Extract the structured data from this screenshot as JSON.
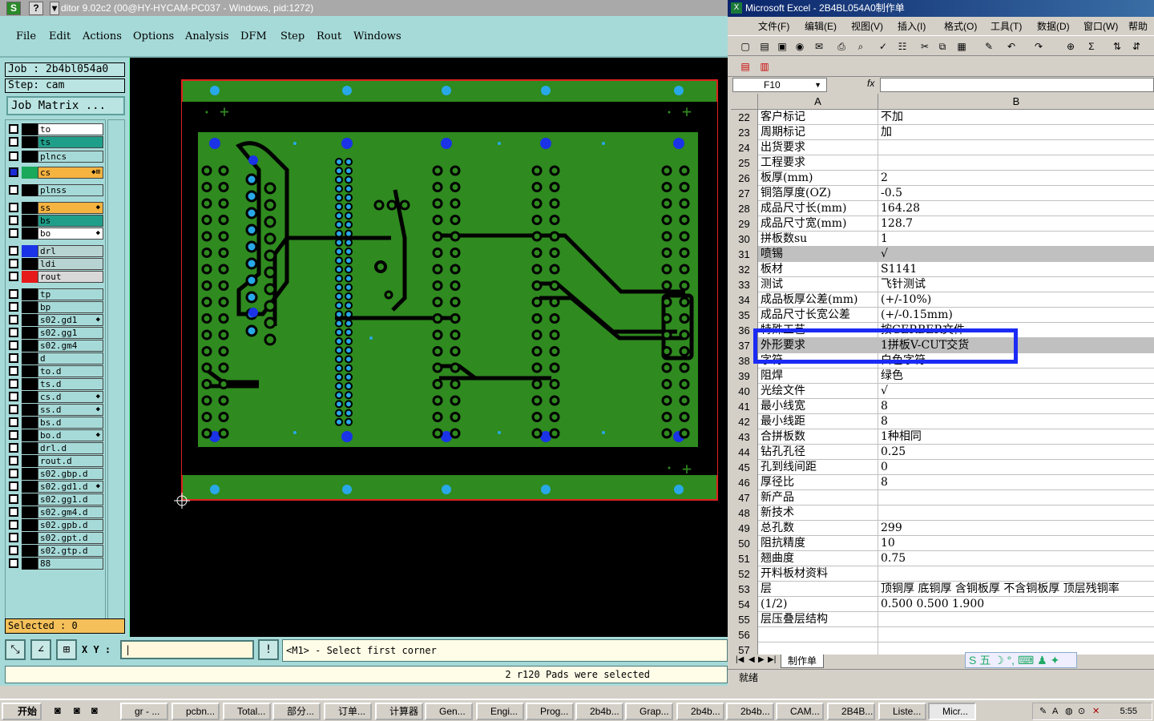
{
  "genesis": {
    "title": "ditor 9.02c2 (00@HY-HYCAM-PC037 - Windows, pid:1272)",
    "menu": [
      "File",
      "Edit",
      "Actions",
      "Options",
      "Analysis",
      "DFM",
      "Step",
      "Rout",
      "Windows"
    ],
    "job": "Job : 2b4bl054a0",
    "step": "Step: cam",
    "job_matrix": "Job Matrix ...",
    "layers": [
      {
        "name": "to",
        "color": "#000000",
        "bg": "#ffffff"
      },
      {
        "name": "ts",
        "color": "#000000",
        "bg": "#1f9f8a"
      },
      {
        "name": "plncs",
        "color": "#000000",
        "bg": "#a6dad8"
      },
      {
        "name": "cs",
        "color": "#1aa85a",
        "bg": "#f5b340",
        "mark": "◆⊞"
      },
      {
        "name": "plnss",
        "color": "#000000",
        "bg": "#a6dad8"
      },
      {
        "name": "ss",
        "color": "#000000",
        "bg": "#f5b340",
        "mark": "◆"
      },
      {
        "name": "bs",
        "color": "#000000",
        "bg": "#1f9f8a"
      },
      {
        "name": "bo",
        "color": "#000000",
        "bg": "#ffffff",
        "mark": "◆"
      },
      {
        "name": "drl",
        "color": "#1a33e6",
        "bg": "#b8d4d2"
      },
      {
        "name": "ldi",
        "color": "#000000",
        "bg": "#b8d4d2"
      },
      {
        "name": "rout",
        "color": "#e61a1a",
        "bg": "#d8d8d8"
      },
      {
        "name": "tp",
        "color": "#000000",
        "bg": "#a6dad8"
      },
      {
        "name": "bp",
        "color": "#000000",
        "bg": "#a6dad8"
      },
      {
        "name": "s02.gd1",
        "color": "#000000",
        "bg": "#a6dad8",
        "mark": "◆"
      },
      {
        "name": "s02.gg1",
        "color": "#000000",
        "bg": "#a6dad8"
      },
      {
        "name": "s02.gm4",
        "color": "#000000",
        "bg": "#a6dad8"
      },
      {
        "name": "d",
        "color": "#000000",
        "bg": "#a6dad8"
      },
      {
        "name": "to.d",
        "color": "#000000",
        "bg": "#a6dad8"
      },
      {
        "name": "ts.d",
        "color": "#000000",
        "bg": "#a6dad8"
      },
      {
        "name": "cs.d",
        "color": "#000000",
        "bg": "#a6dad8",
        "mark": "◆"
      },
      {
        "name": "ss.d",
        "color": "#000000",
        "bg": "#a6dad8",
        "mark": "◆"
      },
      {
        "name": "bs.d",
        "color": "#000000",
        "bg": "#a6dad8"
      },
      {
        "name": "bo.d",
        "color": "#000000",
        "bg": "#a6dad8",
        "mark": "◆"
      },
      {
        "name": "drl.d",
        "color": "#000000",
        "bg": "#a6dad8"
      },
      {
        "name": "rout.d",
        "color": "#000000",
        "bg": "#a6dad8"
      },
      {
        "name": "s02.gbp.d",
        "color": "#000000",
        "bg": "#a6dad8"
      },
      {
        "name": "s02.gd1.d",
        "color": "#000000",
        "bg": "#a6dad8",
        "mark": "◆"
      },
      {
        "name": "s02.gg1.d",
        "color": "#000000",
        "bg": "#a6dad8"
      },
      {
        "name": "s02.gm4.d",
        "color": "#000000",
        "bg": "#a6dad8"
      },
      {
        "name": "s02.gpb.d",
        "color": "#000000",
        "bg": "#a6dad8"
      },
      {
        "name": "s02.gpt.d",
        "color": "#000000",
        "bg": "#a6dad8"
      },
      {
        "name": "s02.gtp.d",
        "color": "#000000",
        "bg": "#a6dad8"
      },
      {
        "name": "88",
        "color": "#000000",
        "bg": "#a6dad8"
      }
    ],
    "selected": "Selected : 0",
    "xy_label": "X Y :",
    "xy_value": "",
    "prompt": "<M1> - Select first corner",
    "status": "2 r120 Pads were selected"
  },
  "excel": {
    "title": "Microsoft Excel - 2B4BL054A0制作单",
    "menu": [
      "文件(F)",
      "编辑(E)",
      "视图(V)",
      "插入(I)",
      "格式(O)",
      "工具(T)",
      "数据(D)",
      "窗口(W)",
      "帮助"
    ],
    "name_box": "F10",
    "fx": "fx",
    "col_a": "A",
    "col_b": "B",
    "rows": [
      {
        "n": "22",
        "a": "客户标记",
        "b": "不加"
      },
      {
        "n": "23",
        "a": "周期标记",
        "b": "加"
      },
      {
        "n": "24",
        "a": "出货要求",
        "b": ""
      },
      {
        "n": "25",
        "a": "工程要求",
        "b": ""
      },
      {
        "n": "26",
        "a": "板厚(mm)",
        "b": "2"
      },
      {
        "n": "27",
        "a": "铜箔厚度(OZ)",
        "b": "-0.5"
      },
      {
        "n": "28",
        "a": "成品尺寸长(mm)",
        "b": "164.28"
      },
      {
        "n": "29",
        "a": "成品尺寸宽(mm)",
        "b": "128.7"
      },
      {
        "n": "30",
        "a": "拼板数su",
        "b": "1"
      },
      {
        "n": "31",
        "a": "喷锡",
        "b": "√",
        "gray": true
      },
      {
        "n": "32",
        "a": "板材",
        "b": "S1141"
      },
      {
        "n": "33",
        "a": "测试",
        "b": "飞针测试"
      },
      {
        "n": "34",
        "a": "成品板厚公差(mm)",
        "b": "(+/-10%)"
      },
      {
        "n": "35",
        "a": "成品尺寸长宽公差",
        "b": "(+/-0.15mm)"
      },
      {
        "n": "36",
        "a": "特殊工艺",
        "b": "按GERBER文件"
      },
      {
        "n": "37",
        "a": "外形要求",
        "b": "1拼板V-CUT交货",
        "gray": true
      },
      {
        "n": "38",
        "a": "字符",
        "b": "白色字符"
      },
      {
        "n": "39",
        "a": "阻焊",
        "b": "绿色"
      },
      {
        "n": "40",
        "a": "光绘文件",
        "b": "√"
      },
      {
        "n": "41",
        "a": "最小线宽",
        "b": "8"
      },
      {
        "n": "42",
        "a": "最小线距",
        "b": "8"
      },
      {
        "n": "43",
        "a": "合拼板数",
        "b": "1种相同"
      },
      {
        "n": "44",
        "a": "钻孔孔径",
        "b": "0.25"
      },
      {
        "n": "45",
        "a": "孔到线间距",
        "b": "0"
      },
      {
        "n": "46",
        "a": "厚径比",
        "b": "8"
      },
      {
        "n": "47",
        "a": "新产品",
        "b": ""
      },
      {
        "n": "48",
        "a": "新技术",
        "b": ""
      },
      {
        "n": "49",
        "a": "总孔数",
        "b": "299"
      },
      {
        "n": "50",
        "a": "阻抗精度",
        "b": "10"
      },
      {
        "n": "51",
        "a": "翘曲度",
        "b": "0.75"
      },
      {
        "n": "52",
        "a": "开料板材资料",
        "b": ""
      },
      {
        "n": "53",
        "a": "层",
        "b": "顶铜厚  底铜厚  含铜板厚  不含铜板厚  顶层残铜率"
      },
      {
        "n": "54",
        "a": "(1/2)",
        "b": "0.500  0.500   1.900"
      },
      {
        "n": "55",
        "a": "层压叠层结构",
        "b": ""
      },
      {
        "n": "56",
        "a": "",
        "b": ""
      },
      {
        "n": "57",
        "a": "",
        "b": ""
      }
    ],
    "sheet_tab": "制作单",
    "ime": "五",
    "status": "就绪"
  },
  "taskbar": {
    "start": "开始",
    "tasks": [
      "gr - ...",
      "pcbn...",
      "Total...",
      "部分...",
      "订单...",
      "计算器",
      "Gen...",
      "Engi...",
      "Prog...",
      "2b4b...",
      "Grap...",
      "2b4b...",
      "2b4b...",
      "CAM...",
      "2B4B...",
      "Liste...",
      "Micr..."
    ],
    "clock": "5:55"
  }
}
